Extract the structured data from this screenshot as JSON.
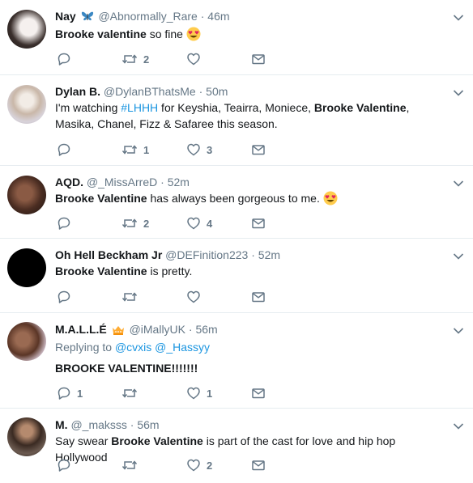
{
  "tweets": [
    {
      "name": "Nay",
      "name_emoji": "butterfly",
      "handle": "@Abnormally_Rare",
      "time": "46m",
      "body": {
        "bold": "Brooke valentine",
        "rest": " so fine"
      },
      "body_emoji": "heart-eyes",
      "retweets": "2",
      "likes": ""
    },
    {
      "name": "Dylan B.",
      "handle": "@DylanBThatsMe",
      "time": "50m",
      "body": {
        "pre": "I'm watching ",
        "hashtag": "#LHHH",
        "mid": " for Keyshia, Teairra, Moniece, ",
        "bold": "Brooke Valentine",
        "rest": ", Masika, Chanel, Fizz & Safaree this season."
      },
      "retweets": "1",
      "likes": "3"
    },
    {
      "name": "AQD.",
      "handle": "@_MissArreD",
      "time": "52m",
      "body": {
        "bold": "Brooke Valentine",
        "rest": " has always been gorgeous to me."
      },
      "body_emoji": "heart-eyes",
      "retweets": "2",
      "likes": "4"
    },
    {
      "name": "Oh Hell Beckham Jr",
      "handle": "@DEFinition223",
      "time": "52m",
      "body": {
        "bold": "Brooke Valentine",
        "rest": " is pretty."
      },
      "retweets": "",
      "likes": ""
    },
    {
      "name": "M.A.L.L.É",
      "name_emoji": "crown",
      "handle": "@iMallyUK",
      "time": "56m",
      "replying": {
        "label": "Replying to",
        "to1": "@cvxis",
        "to2": "@_Hassyy"
      },
      "body": {
        "bold": "BROOKE VALENTINE",
        "rest": "!!!!!!!"
      },
      "replies": "1",
      "retweets": "",
      "likes": "1"
    },
    {
      "name": "M.",
      "handle": "@_maksss",
      "time": "56m",
      "body": {
        "pre": "Say swear ",
        "bold": "Brooke Valentine",
        "rest": " is part of the cast for love and hip hop Hollywood"
      },
      "retweets": "",
      "likes": "2"
    }
  ],
  "colors": {
    "text": "#14171a",
    "secondary": "#657786",
    "link": "#1b95e0",
    "divider": "#e6ecf0"
  }
}
